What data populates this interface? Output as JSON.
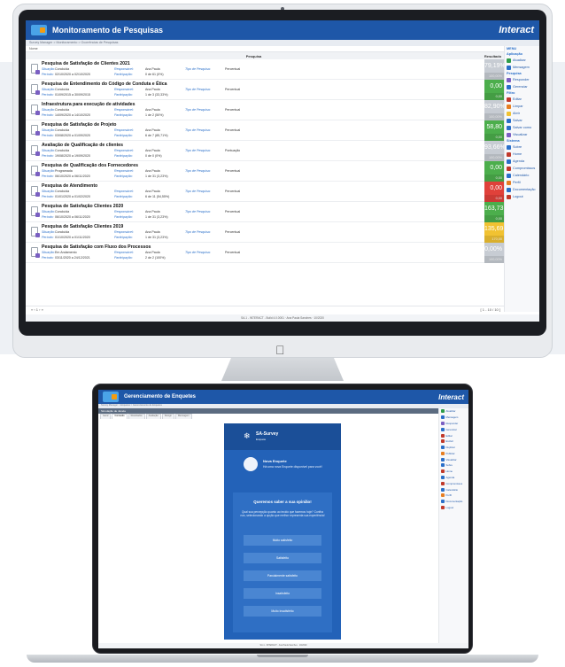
{
  "desktop": {
    "app_title": "Monitoramento de Pesquisas",
    "brand": "Interact",
    "breadcrumb": "Survey Manager  >  Monitoramento  >  Ocorrências de Pesquisas",
    "filter_label": "Nome",
    "columns": {
      "pesquisa": "Pesquisa",
      "resultado": "Resultado"
    },
    "rows": [
      {
        "title": "Pesquisa de Satisfação de Clientes 2021",
        "situacao": "Concluída",
        "periodo": "02/10/2020 a 02/10/2020",
        "responsavel": "Ana Paula",
        "participacao": "0 de 61 (0%)",
        "tipo": "Percentual",
        "score": "79,19%",
        "sub": "100,00%",
        "color": "#c7ccd3"
      },
      {
        "title": "Pesquisa de Entendimento do Código de Conduta e Ética",
        "situacao": "Concluída",
        "periodo": "01/09/2015 a 30/09/2015",
        "responsavel": "Ana Paula",
        "participacao": "1 de 3 (33,33%)",
        "tipo": "Percentual",
        "score": "0,00",
        "sub": "0,00",
        "color": "#4cae4c"
      },
      {
        "title": "Infraestrutura para execução de atividades",
        "situacao": "Concluída",
        "periodo": "14/09/2020 a 14/10/2020",
        "responsavel": "Ana Paula",
        "participacao": "1 de 2 (50%)",
        "tipo": "Percentual",
        "score": "82,90%",
        "sub": "100,00%",
        "color": "#c7ccd3"
      },
      {
        "title": "Pesquisa de Satisfação de Projeto",
        "situacao": "Concluída",
        "periodo": "03/08/2020 a 01/09/2020",
        "responsavel": "Ana Paula",
        "participacao": "6 de 7 (85,71%)",
        "tipo": "Percentual",
        "score": "58,80",
        "sub": "0,00",
        "color": "#4cae4c"
      },
      {
        "title": "Avaliação de Qualificação de clientes",
        "situacao": "Concluída",
        "periodo": "19/08/2020 a 19/09/2020",
        "responsavel": "Ana Paula",
        "participacao": "0 de 0 (0%)",
        "tipo": "Pontuação",
        "score": "93,66%",
        "sub": "100,00%",
        "color": "#c7ccd3"
      },
      {
        "title": "Pesquisa de Qualificação dos Fornecedores",
        "situacao": "Programada",
        "periodo": "06/10/2020 a 06/11/2020",
        "responsavel": "Ana Paula",
        "participacao": "1 de 31 (3,23%)",
        "tipo": "Percentual",
        "score": "0,00",
        "sub": "0,00",
        "color": "#4cae4c"
      },
      {
        "title": "Pesquisa de Atendimento",
        "situacao": "Concluída",
        "periodo": "01/01/2020 a 01/02/2020",
        "responsavel": "Ana Paula",
        "participacao": "6 de 11 (54,55%)",
        "tipo": "Percentual",
        "score": "0,00",
        "sub": "0,00",
        "color": "#e0413a"
      },
      {
        "title": "Pesquisa de Satisfação Clientes 2020",
        "situacao": "Concluída",
        "periodo": "06/10/2020 a 06/11/2020",
        "responsavel": "Ana Paula",
        "participacao": "1 de 31 (3,23%)",
        "tipo": "Percentual",
        "score": "163,73",
        "sub": "0,00",
        "color": "#4cae4c"
      },
      {
        "title": "Pesquisa de Satisfação Clientes 2019",
        "situacao": "Concluída",
        "periodo": "01/10/2020 a 01/11/2020",
        "responsavel": "Ana Paula",
        "participacao": "1 de 31 (3,23%)",
        "tipo": "Percentual",
        "score": "135,69",
        "sub": "170,00",
        "color": "#f1c232"
      },
      {
        "title": "Pesquisa de Satisfação com Fluxo dos Processos",
        "situacao": "Em Andamento",
        "periodo": "03/11/2020 a 24/12/2021",
        "responsavel": "Ana Paula",
        "participacao": "2 de 2 (100%)",
        "tipo": "Percentual",
        "score": "0,00%",
        "sub": "100,00%",
        "color": "#c7ccd3"
      }
    ],
    "labels": {
      "situacao": "Situação:",
      "periodo": "Período:",
      "responsavel": "Responsável:",
      "participacao": "Participação:",
      "tipo": "Tipo de Pesquisa:"
    },
    "pager_left": "1",
    "pager_right": "[ 1 - 10 / 10 ]",
    "status": "SA.1 - INTERACT - Build 4.0.0001 · Ana Paula Sanches · 10/2020",
    "side": {
      "menu": "MENU",
      "sections": [
        {
          "name": "Aplicação",
          "items": [
            {
              "label": "Atualizar",
              "icon": "refresh-icon",
              "color": "#2e9d4a"
            },
            {
              "label": "Mensagem",
              "icon": "message-icon",
              "color": "#2a6fc9"
            }
          ]
        },
        {
          "name": "Pesquisa",
          "items": [
            {
              "label": "Responder",
              "icon": "survey-icon",
              "color": "#7a5fc2"
            },
            {
              "label": "Gerenciar",
              "icon": "manage-icon",
              "color": "#2a6fc9"
            }
          ]
        },
        {
          "name": "Filtro",
          "items": [
            {
              "label": "Editar",
              "icon": "edit-icon",
              "color": "#c0392b"
            },
            {
              "label": "Limpar",
              "icon": "clear-icon",
              "color": "#e67e22"
            },
            {
              "label": "Abrir",
              "icon": "folder-icon",
              "color": "#f1c232"
            },
            {
              "label": "Salvar",
              "icon": "save-icon",
              "color": "#2a6fc9"
            },
            {
              "label": "Salvar como",
              "icon": "save-as-icon",
              "color": "#2a6fc9"
            },
            {
              "label": "Visualizar",
              "icon": "view-icon",
              "color": "#7a5fc2"
            }
          ]
        },
        {
          "name": "Sistema",
          "items": [
            {
              "label": "Sobre",
              "icon": "info-icon",
              "color": "#2a6fc9"
            },
            {
              "label": "Home",
              "icon": "home-icon",
              "color": "#c0392b"
            },
            {
              "label": "Agenda",
              "icon": "agenda-icon",
              "color": "#2a6fc9"
            },
            {
              "label": "Compromissos",
              "icon": "calendar-icon",
              "color": "#c0392b"
            },
            {
              "label": "Calendário",
              "icon": "calendar-grid-icon",
              "color": "#2a6fc9"
            },
            {
              "label": "Perfil",
              "icon": "profile-icon",
              "color": "#e67e22"
            },
            {
              "label": "Documentação",
              "icon": "docs-icon",
              "color": "#2a6fc9"
            },
            {
              "label": "Logout",
              "icon": "logout-icon",
              "color": "#c0392b"
            }
          ]
        }
      ]
    }
  },
  "laptop": {
    "app_title": "Gerenciamento de Enquetes",
    "brand": "Interact",
    "breadcrumb": "Survey Manager  >  Enquetes  >  Gerenciamento de Enquetes",
    "bar_title": "Simulação de Janela",
    "tabs": [
      "Geral",
      "Conteúdo",
      "Resultados",
      "Avaliação",
      "Design",
      "Mensagem"
    ],
    "phone": {
      "app_name": "SA-Survey",
      "app_sub": "Enquete",
      "notif_title": "Nova Enquete",
      "notif_text": "Há uma nova Enquete disponível para você!",
      "question": "Queremos saber a sua opinião!",
      "description": "Qual sua percepção quanto ao tecido que fazemos hoje? Confira nos, selecionando a opção que melhor representa sua experiência!",
      "options": [
        "Muito satisfeito",
        "Satisfeito",
        "Parcialmente satisfeito",
        "Insatisfeito",
        "Muito insatisfeito"
      ]
    },
    "side_items": [
      "Atualizar",
      "Mensagem",
      "Responder",
      "Gerenciar",
      "Editar",
      "Excluir",
      "Duplicar",
      "Publicar",
      "Visualizar",
      "Sobre",
      "Home",
      "Agenda",
      "Compromissos",
      "Calendário",
      "Perfil",
      "Documentação",
      "Logout"
    ],
    "status": "SA.1 - INTERACT · Ana Paula Sanches · 10/2020"
  }
}
